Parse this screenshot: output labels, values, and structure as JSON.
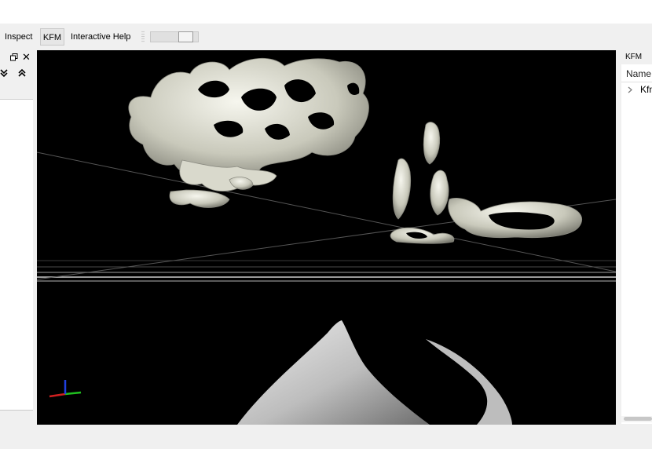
{
  "toolbar": {
    "inspect_label": "Inspect",
    "kfm_label": "KFM",
    "help_label": "Interactive Help",
    "slider_value": 0.85
  },
  "left_dock": {
    "float_icon": "dock-float-icon",
    "close_glyph": "✕",
    "collapse_icon": "chevron-down-double-icon",
    "expand_icon": "chevron-up-double-icon"
  },
  "right_dock": {
    "title": "KFM",
    "column_header": "Name",
    "items": [
      {
        "label": "Kfm",
        "expanded": false
      }
    ]
  },
  "viewport": {
    "background": "#000000",
    "axis_colors": {
      "x": "#d02020",
      "y": "#20c020",
      "z": "#2040e0"
    }
  }
}
